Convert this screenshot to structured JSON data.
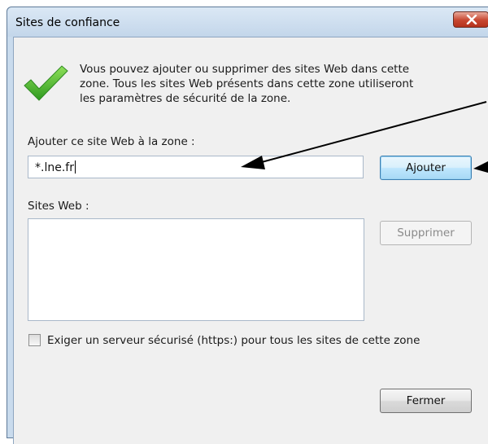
{
  "dialog": {
    "title": "Sites de confiance"
  },
  "intro": {
    "line1": "Vous pouvez ajouter ou supprimer des sites Web dans cette",
    "line2": "zone. Tous les sites Web présents dans cette zone utiliseront",
    "line3": "les paramètres de sécurité de la zone."
  },
  "add_site": {
    "label": "Ajouter ce site Web à la zone :",
    "value": "*.lne.fr",
    "button_label": "Ajouter"
  },
  "sites": {
    "label": "Sites Web :",
    "items": [],
    "remove_label": "Supprimer"
  },
  "https_option": {
    "label": "Exiger un serveur sécurisé (https:) pour tous les sites de cette zone",
    "checked": false
  },
  "close_button_label": "Fermer",
  "colors": {
    "titlebar": "#c9dbed",
    "close_button": "#c7462f",
    "check_icon": "#4fb52c",
    "annotation_arrow": "#000000"
  }
}
